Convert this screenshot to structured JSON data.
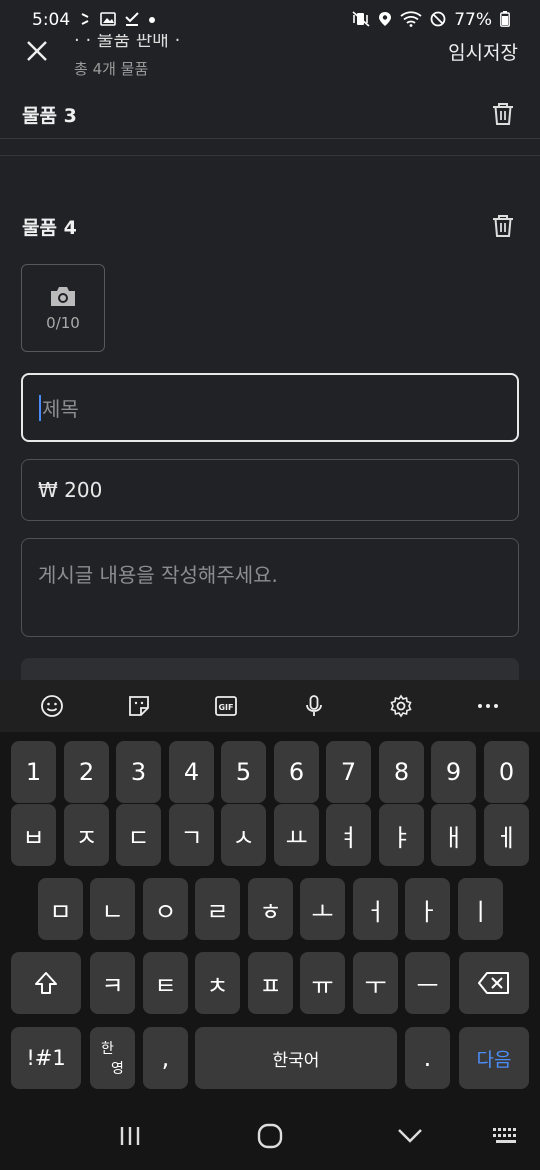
{
  "status": {
    "time": "5:04",
    "battery": "77%"
  },
  "header": {
    "title": "· · 물품 판매 ·",
    "subtitle": "총 4개 물품",
    "save_label": "임시저장"
  },
  "items": [
    {
      "label": "물품 3"
    },
    {
      "label": "물품 4"
    }
  ],
  "photo": {
    "count": "0/10"
  },
  "form": {
    "title_placeholder": "제목",
    "price_value": "₩ 200",
    "content_placeholder": "게시글 내용을 작성해주세요."
  },
  "keyboard": {
    "row_numbers": [
      "1",
      "2",
      "3",
      "4",
      "5",
      "6",
      "7",
      "8",
      "9",
      "0"
    ],
    "row_1": [
      "ㅂ",
      "ㅈ",
      "ㄷ",
      "ㄱ",
      "ㅅ",
      "ㅛ",
      "ㅕ",
      "ㅑ",
      "ㅐ",
      "ㅔ"
    ],
    "row_2": [
      "ㅁ",
      "ㄴ",
      "ㅇ",
      "ㄹ",
      "ㅎ",
      "ㅗ",
      "ㅓ",
      "ㅏ",
      "ㅣ"
    ],
    "row_3": [
      "ㅋ",
      "ㅌ",
      "ㅊ",
      "ㅍ",
      "ㅠ",
      "ㅜ",
      "ㅡ"
    ],
    "symbols_label": "!#1",
    "lang_label_top": "한",
    "lang_label_bottom": "영",
    "comma_label": ",",
    "space_label": "한국어",
    "period_label": ".",
    "done_label": "다음"
  },
  "icons": {
    "toolbar": [
      "emoji-icon",
      "sticker-icon",
      "gif-icon",
      "mic-icon",
      "settings-icon",
      "more-icon"
    ]
  },
  "colors": {
    "background": "#212225",
    "accent": "#4c8df6",
    "keyboard_bg": "#151515",
    "key_bg": "#3a3a3b"
  }
}
